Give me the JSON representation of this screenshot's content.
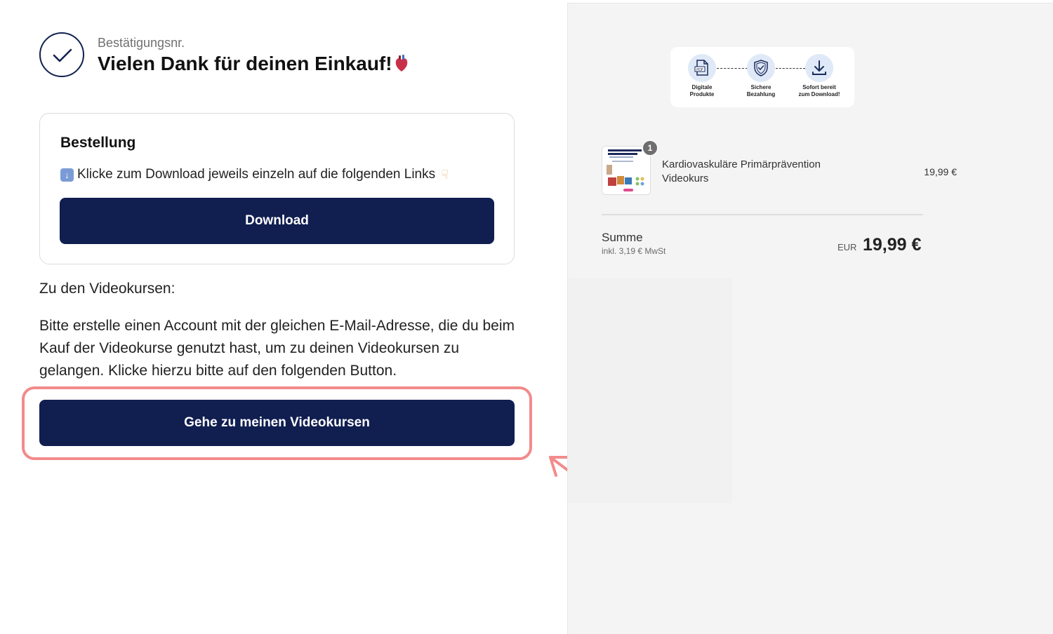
{
  "confirmation": {
    "label": "Bestätigungsnr.",
    "title": "Vielen Dank für deinen Einkauf!"
  },
  "order": {
    "title": "Bestellung",
    "hint": "Klicke zum Download jeweils einzeln auf die folgenden Links",
    "download_label": "Download"
  },
  "videos": {
    "heading": "Zu den Videokursen:",
    "text": "Bitte erstelle einen Account mit der gleichen E-Mail-Adresse, die du beim Kauf der Videokurse genutzt hast, um zu deinen Videokursen zu gelangen. Klicke hierzu bitte auf den folgenden Button.",
    "button_label": "Gehe zu meinen Videokursen"
  },
  "trust": {
    "items": [
      {
        "label": "Digitale\nProdukte",
        "icon": "pdf-document-icon"
      },
      {
        "label": "Sichere\nBezahlung",
        "icon": "shield-check-icon"
      },
      {
        "label": "Sofort bereit\nzum Download!",
        "icon": "download-icon"
      }
    ]
  },
  "cart": {
    "items": [
      {
        "quantity": "1",
        "name": "Kardiovaskuläre Primärprävention Videokurs",
        "price": "19,99 €"
      }
    ],
    "sum_label": "Summe",
    "tax_note": "inkl. 3,19 € MwSt",
    "currency": "EUR",
    "total": "19,99 €"
  },
  "colors": {
    "primary": "#101e50",
    "highlight": "#f28b8b",
    "right_bg": "#f4f4f4"
  }
}
